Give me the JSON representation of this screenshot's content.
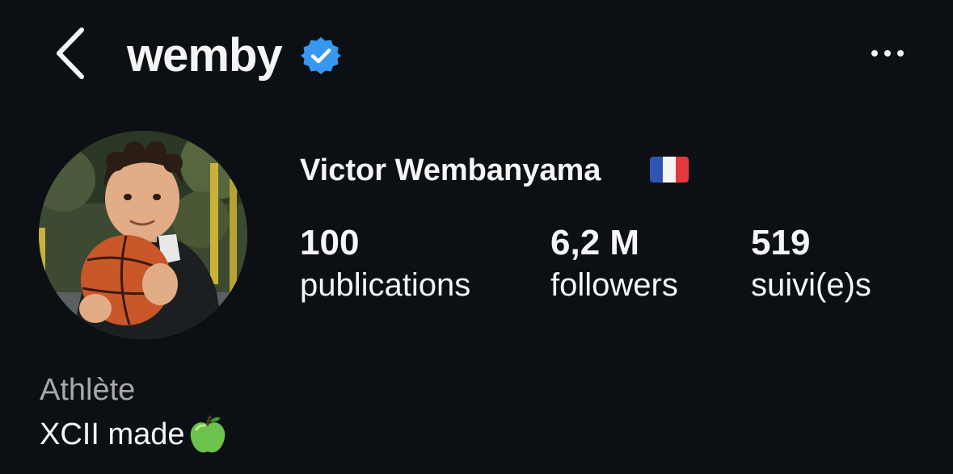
{
  "header": {
    "username": "wemby",
    "verified": true,
    "back_icon": "chevron-left-icon",
    "more_icon": "ellipsis-icon"
  },
  "profile": {
    "full_name": "Victor Wembanyama",
    "flag": "france-flag",
    "avatar": "profile-photo"
  },
  "stats": [
    {
      "value": "100",
      "label": "publications"
    },
    {
      "value": "6,2 M",
      "label": "followers"
    },
    {
      "value": "519",
      "label": "suivi(e)s"
    }
  ],
  "bio": {
    "category": "Athlète",
    "text": "XCII made",
    "emoji": "green-apple-icon"
  },
  "colors": {
    "background": "#0c1014",
    "text": "#f5f5f5",
    "secondary_text": "#a8a8a8",
    "verified_blue": "#3897f0"
  }
}
